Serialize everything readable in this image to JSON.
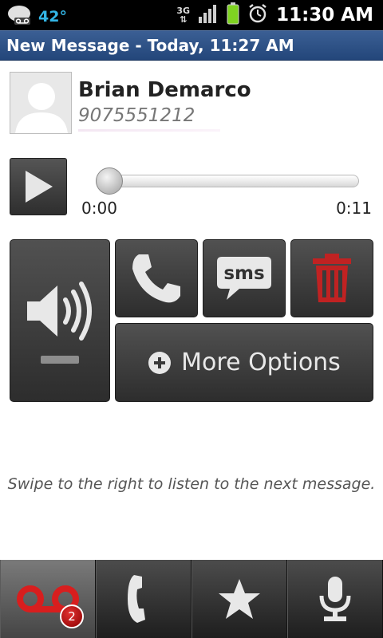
{
  "status_bar": {
    "temperature": "42°",
    "network": "3G",
    "time": "11:30 AM"
  },
  "title_bar": {
    "title": "New Message - Today, 11:27 AM"
  },
  "contact": {
    "name": "Brian Demarco",
    "number": "9075551212"
  },
  "player": {
    "elapsed": "0:00",
    "duration": "0:11",
    "progress": 0
  },
  "actions": {
    "sms_label": "sms",
    "more_options_label": "More Options"
  },
  "hint": "Swipe to the right to listen to the next message.",
  "tab_bar": {
    "voicemail_badge": "2"
  },
  "colors": {
    "title_bar": "#2c4f86",
    "temperature": "#33b5e5",
    "voicemail_icon": "#d81e1e",
    "delete_icon": "#c02222"
  }
}
